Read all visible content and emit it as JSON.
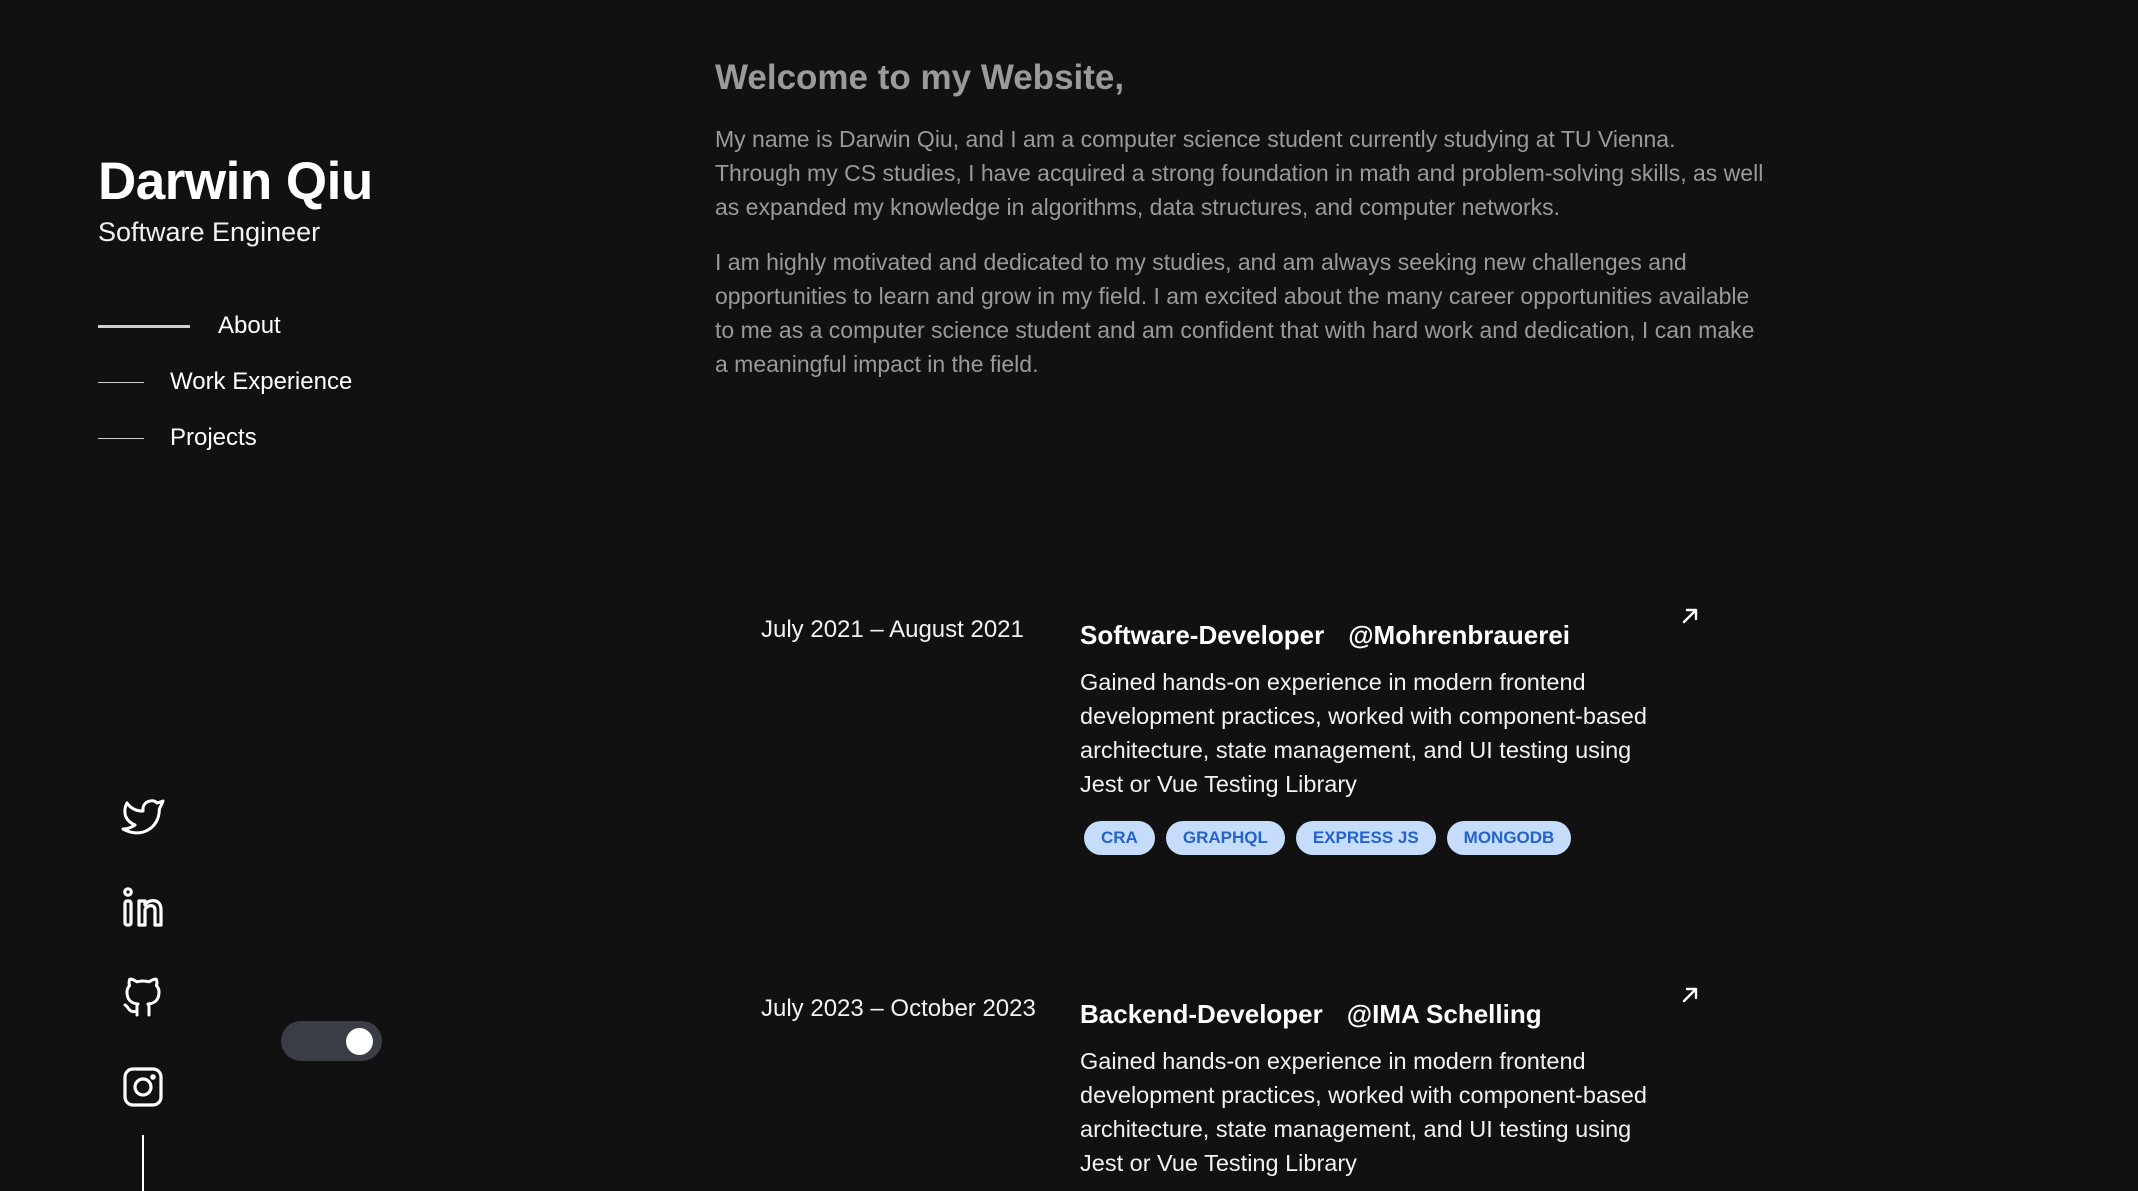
{
  "profile": {
    "name": "Darwin Qiu",
    "role": "Software Engineer"
  },
  "nav": {
    "items": [
      {
        "label": "About",
        "active": true
      },
      {
        "label": "Work Experience",
        "active": false
      },
      {
        "label": "Projects",
        "active": false
      }
    ]
  },
  "socials": [
    {
      "icon": "twitter-icon"
    },
    {
      "icon": "linkedin-icon"
    },
    {
      "icon": "github-icon"
    },
    {
      "icon": "instagram-icon"
    }
  ],
  "theme_toggle": {
    "state": "on"
  },
  "about": {
    "heading": "Welcome to my Website,",
    "paragraphs": [
      "My name is Darwin Qiu, and I am a computer science student currently studying at TU Vienna. Through my CS studies, I have acquired a strong foundation in math and problem-solving skills, as well as expanded my knowledge in algorithms, data structures, and computer networks.",
      "I am highly motivated and dedicated to my studies, and am always seeking new challenges and opportunities to learn and grow in my field. I am excited about the many career opportunities available to me as a computer science student and am confident that with hard work and dedication, I can make a meaningful impact in the field."
    ]
  },
  "experience": [
    {
      "date": "July 2021 – August 2021",
      "title": "Software-Developer",
      "company": "@Mohrenbrauerei",
      "description": "Gained hands-on experience in modern frontend development practices, worked with component-based architecture, state management, and UI testing using Jest or Vue Testing Library",
      "tags": [
        "CRA",
        "GRAPHQL",
        "EXPRESS JS",
        "MONGODB"
      ]
    },
    {
      "date": "July 2023 – October 2023",
      "title": "Backend-Developer",
      "company": "@IMA Schelling",
      "description": "Gained hands-on experience in modern frontend development practices, worked with component-based architecture, state management, and UI testing using Jest or Vue Testing Library",
      "tags": []
    }
  ],
  "colors": {
    "background": "#111112",
    "muted_text": "#9a9a9a",
    "tag_bg": "#c5dcfb",
    "tag_text": "#2563c9",
    "toggle_track": "#3a3e44"
  }
}
